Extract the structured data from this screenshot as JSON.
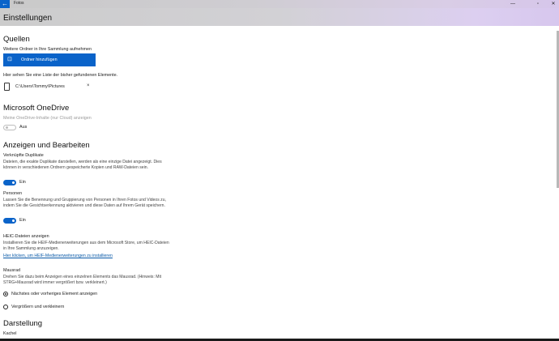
{
  "window": {
    "app_name": "Fotos",
    "back_glyph": "←",
    "minimize_glyph": "—",
    "maximize_glyph": "▫",
    "close_glyph": "✕"
  },
  "header": {
    "title": "Einstellungen"
  },
  "sources": {
    "heading": "Quellen",
    "add_text": "Weitere Ordner in Ihre Sammlung aufnehmen",
    "add_button_icon": "folder-add-icon",
    "add_button_label": "Ordner hinzufügen",
    "list_text": "Hier sehen Sie eine Liste der bisher gefundenen Elemente.",
    "folders": [
      {
        "path": "C:\\Users\\Tommy\\Pictures",
        "remove_glyph": "×"
      }
    ]
  },
  "onedrive": {
    "heading": "Microsoft OneDrive",
    "label": "Meine OneDrive-Inhalte (nur Cloud) anzeigen",
    "toggle_state": "Aus"
  },
  "view_edit": {
    "heading": "Anzeigen und Bearbeiten",
    "duplicates": {
      "label": "Verknüpfte Duplikate",
      "description": "Dateien, die exakte Duplikate darstellen, werden als eine einzige Datei angezeigt. Dies können in verschiedenen Ordnern gespeicherte Kopien und RAW-Dateien sein.",
      "toggle_state": "Ein"
    },
    "people": {
      "label": "Personen",
      "description": "Lassen Sie die Benennung und Gruppierung von Personen in Ihren Fotos und Videos zu, indem Sie die Gesichtserkennung aktivieren und diese Daten auf Ihrem Gerät speichern.",
      "toggle_state": "Ein"
    },
    "heic": {
      "label": "HEIC-Dateien anzeigen",
      "description": "Installieren Sie die HEIF-Medienerweiterungen aus dem Microsoft Store, um HEIC-Dateien in Ihre Sammlung anzuzeigen.",
      "link": "Hier klicken, um HEIF-Medienerweiterungen zu installieren"
    },
    "mousewheel": {
      "label": "Mausrad",
      "description": "Drehen Sie dazu beim Anzeigen eines einzelnen Elements das Mausrad. (Hinweis: Mit STRG+Mausrad wird immer vergrößert bzw. verkleinert.)",
      "options": [
        "Nächstes oder vorheriges Element anzeigen",
        "Vergrößern und verkleinern"
      ],
      "selected": "Nächstes oder vorheriges Element anzeigen"
    }
  },
  "display": {
    "heading": "Darstellung",
    "sub_label": "Kachel"
  }
}
